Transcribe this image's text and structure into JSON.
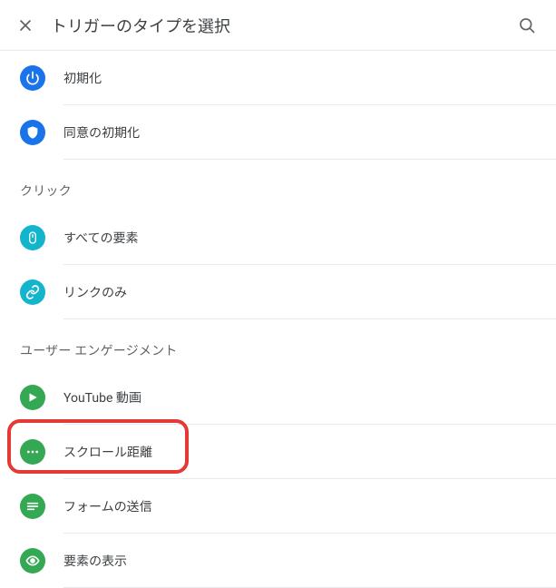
{
  "header": {
    "title": "トリガーのタイプを選択"
  },
  "sections": {
    "prev": {
      "items": [
        {
          "label": "初期化"
        },
        {
          "label": "同意の初期化"
        }
      ]
    },
    "click": {
      "title": "クリック",
      "items": [
        {
          "label": "すべての要素"
        },
        {
          "label": "リンクのみ"
        }
      ]
    },
    "engagement": {
      "title": "ユーザー エンゲージメント",
      "items": [
        {
          "label": "YouTube 動画"
        },
        {
          "label": "スクロール距離"
        },
        {
          "label": "フォームの送信"
        },
        {
          "label": "要素の表示"
        }
      ]
    }
  }
}
